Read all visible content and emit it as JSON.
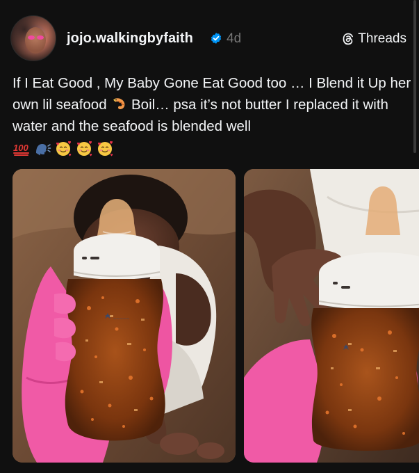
{
  "post": {
    "username": "jojo.walkingbyfaith",
    "time": "4d",
    "brand": "Threads",
    "caption_part1": "If I Eat Good , My Baby Gone Eat Good too … I Blend it Up her own lil seafood ",
    "caption_part2": " Boil… psa it’s not butter I replaced it with water and the seafood is blended well",
    "icons": {
      "verified": "verified-badge-icon",
      "threads": "threads-logo-icon",
      "shrimp": "shrimp-emoji",
      "hundred": "hundred-points-emoji",
      "speaking": "speaking-head-emoji",
      "smiling_hearts": "smiling-face-with-hearts-emoji"
    },
    "colors": {
      "background": "#101010",
      "text": "#f3f5f7",
      "muted": "#777777",
      "verified": "#0095f6",
      "glove_pink": "#f05aa6",
      "bottle_liquid": "#8a3f12"
    }
  },
  "media": [
    {
      "label": "photo-1"
    },
    {
      "label": "photo-2"
    }
  ]
}
